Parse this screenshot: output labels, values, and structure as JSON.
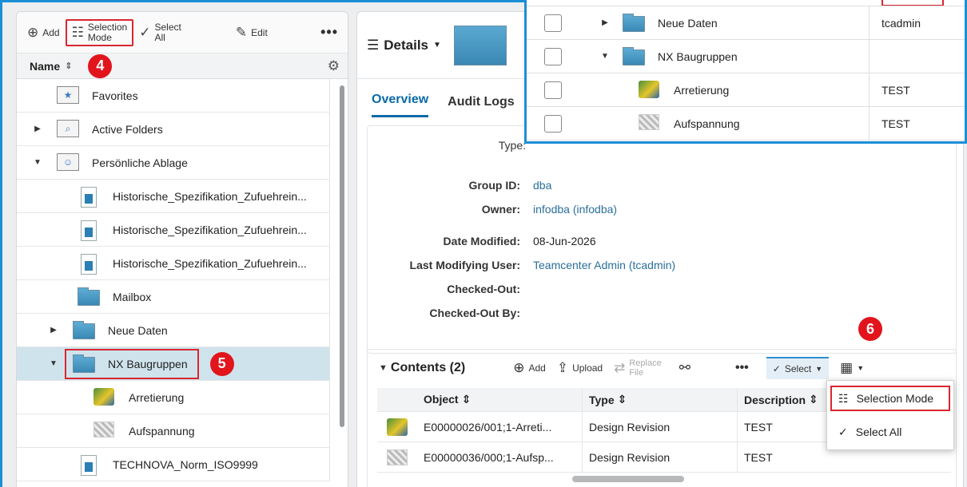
{
  "left_toolbar": {
    "add": "Add",
    "selection_line1": "Selection",
    "selection_line2": "Mode",
    "select_all_line1": "Select",
    "select_all_line2": "All",
    "edit": "Edit",
    "more": "•••"
  },
  "left_header": {
    "name": "Name",
    "badge": "4"
  },
  "tree": {
    "favorites": "Favorites",
    "active_folders": "Active Folders",
    "personal": "Persönliche Ablage",
    "hist1": "Historische_Spezifikation_Zufuehrein...",
    "hist2": "Historische_Spezifikation_Zufuehrein...",
    "hist3": "Historische_Spezifikation_Zufuehrein...",
    "mailbox": "Mailbox",
    "neue_daten": "Neue Daten",
    "nx_baugruppen": "NX Baugruppen",
    "nx_badge": "5",
    "arretierung": "Arretierung",
    "aufspannung": "Aufspannung",
    "technova": "TECHNOVA_Norm_ISO9999"
  },
  "right": {
    "details": "Details",
    "tabs": {
      "overview": "Overview",
      "audit": "Audit Logs"
    },
    "props": {
      "type_label": "Type:",
      "group_label": "Group ID:",
      "group_value": "dba",
      "owner_label": "Owner:",
      "owner_value": "infodba (infodba)",
      "date_label": "Date Modified:",
      "date_value": "08-Jun-2026",
      "lmu_label": "Last Modifying User:",
      "lmu_value": "Teamcenter Admin (tcadmin)",
      "co_label": "Checked-Out:",
      "coby_label": "Checked-Out By:"
    },
    "contents": {
      "title": "Contents (2)",
      "add": "Add",
      "upload": "Upload",
      "replace_line1": "Replace",
      "replace_line2": "File",
      "more": "•••",
      "select": "Select",
      "badge": "6",
      "headers": {
        "object": "Object",
        "type": "Type",
        "description": "Description"
      },
      "rows": [
        {
          "object": "E00000026/001;1-Arreti...",
          "type": "Design Revision",
          "description": "TEST"
        },
        {
          "object": "E00000036/000;1-Aufsp...",
          "type": "Design Revision",
          "description": "TEST"
        }
      ]
    },
    "dropdown": {
      "selection_mode": "Selection Mode",
      "select_all": "Select All"
    }
  },
  "overlay": {
    "rows": [
      {
        "name": "Neue Daten",
        "owner": "tcadmin"
      },
      {
        "name": "NX Baugruppen",
        "owner": ""
      },
      {
        "name": "Arretierung",
        "owner": "TEST"
      },
      {
        "name": "Aufspannung",
        "owner": "TEST"
      }
    ]
  }
}
